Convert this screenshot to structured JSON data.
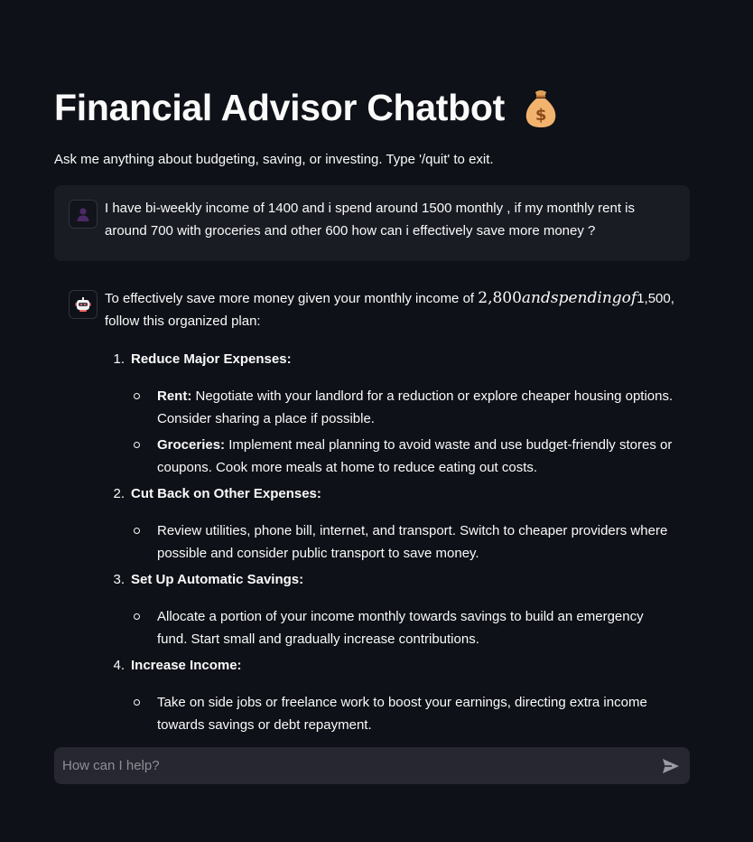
{
  "header": {
    "title": "Financial Advisor Chatbot",
    "title_icon": "money-bag-icon",
    "subtitle": "Ask me anything about budgeting, saving, or investing. Type '/quit' to exit."
  },
  "colors": {
    "background": "#0e1117",
    "user_bubble": "#1a1c24",
    "input_bg": "#262730",
    "text": "#fafafa",
    "placeholder": "#8e8f96"
  },
  "messages": {
    "user": {
      "avatar_icon": "user-avatar-icon",
      "text": "I have bi-weekly income of 1400 and i spend around 1500 monthly , if my monthly rent is around 700 with groceries and other 600 how can i effectively save more money ?"
    },
    "assistant": {
      "avatar_icon": "robot-avatar-icon",
      "intro_prefix": "To effectively save more money given your monthly income of ",
      "intro_math": "2,800andspendingof",
      "intro_suffix": "1,500, follow this organized plan:",
      "steps": [
        {
          "num": "1.",
          "heading": "Reduce Major Expenses:",
          "bullets": [
            {
              "label": "Rent:",
              "text": " Negotiate with your landlord for a reduction or explore cheaper housing options. Consider sharing a place if possible."
            },
            {
              "label": "Groceries:",
              "text": " Implement meal planning to avoid waste and use budget-friendly stores or coupons. Cook more meals at home to reduce eating out costs."
            }
          ]
        },
        {
          "num": "2.",
          "heading": "Cut Back on Other Expenses:",
          "bullets": [
            {
              "label": "",
              "text": "Review utilities, phone bill, internet, and transport. Switch to cheaper providers where possible and consider public transport to save money."
            }
          ]
        },
        {
          "num": "3.",
          "heading": "Set Up Automatic Savings:",
          "bullets": [
            {
              "label": "",
              "text": "Allocate a portion of your income monthly towards savings to build an emergency fund. Start small and gradually increase contributions."
            }
          ]
        },
        {
          "num": "4.",
          "heading": "Increase Income:",
          "bullets": [
            {
              "label": "",
              "text": "Take on side jobs or freelance work to boost your earnings, directing extra income towards savings or debt repayment."
            }
          ]
        }
      ]
    }
  },
  "chat_input": {
    "placeholder": "How can I help?",
    "value": "",
    "send_icon": "send-icon"
  }
}
